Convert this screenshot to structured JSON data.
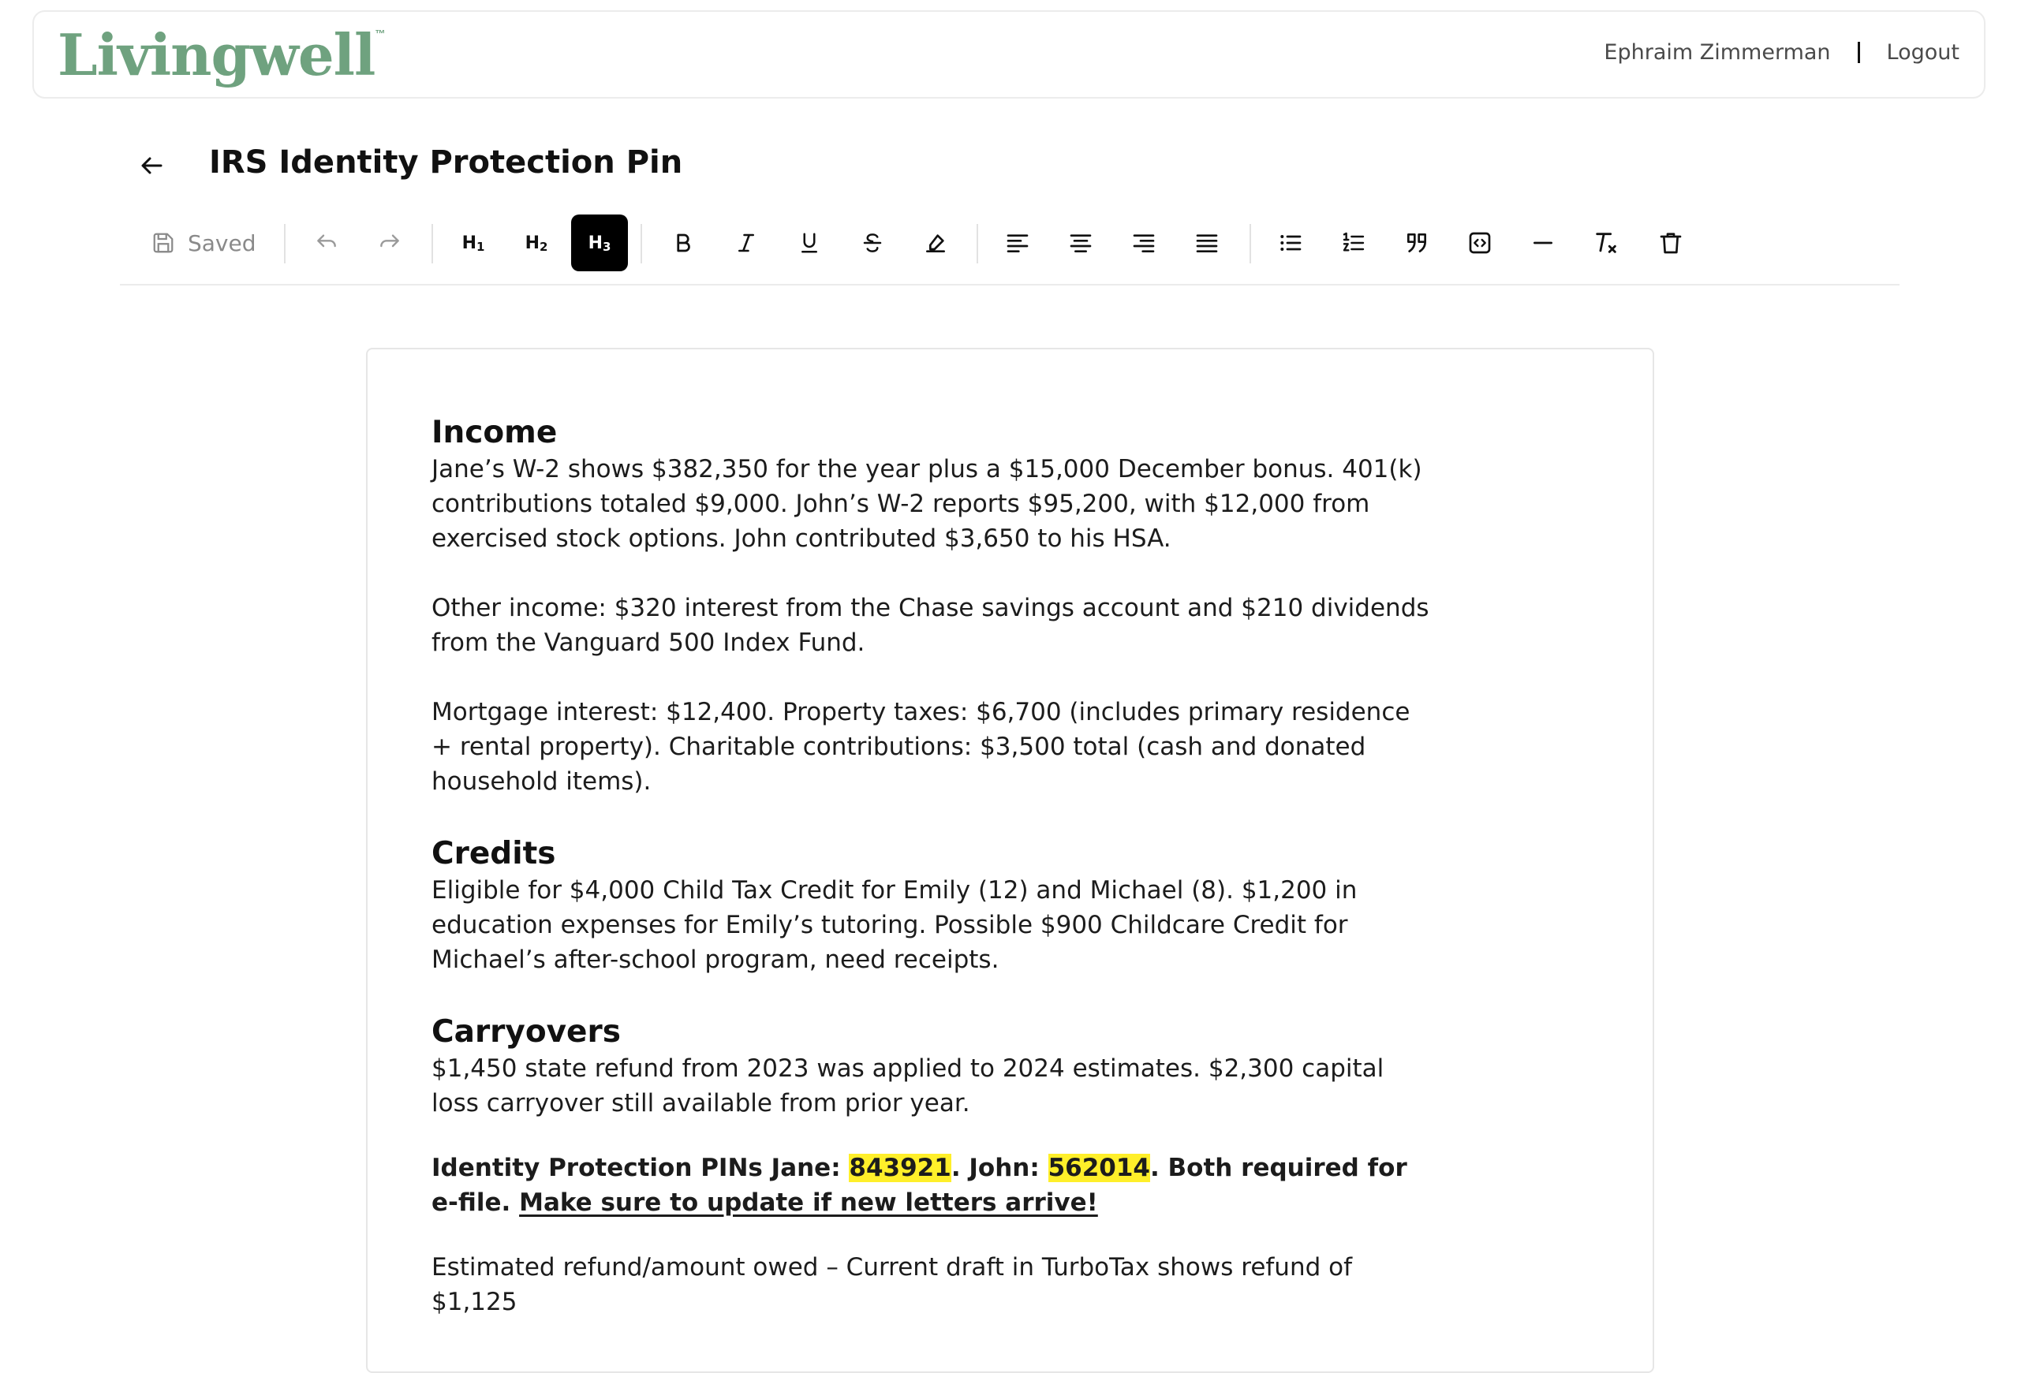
{
  "header": {
    "logo_text": "Livingwell",
    "logo_mark": "™",
    "user_name": "Ephraim Zimmerman",
    "logout_label": "Logout"
  },
  "document": {
    "title": "IRS Identity Protection Pin"
  },
  "toolbar": {
    "saved_label": "Saved",
    "h1_label": "H",
    "h1_sub": "1",
    "h2_label": "H",
    "h2_sub": "2",
    "h3_label": "H",
    "h3_sub": "3",
    "active_heading": "H3"
  },
  "content": {
    "income_heading": "Income",
    "income_p1": "Jane’s W-2 shows $382,350 for the year plus a $15,000 December bonus. 401(k) contributions totaled $9,000. John’s W-2 reports $95,200, with $12,000 from exercised stock options. John contributed $3,650 to his HSA.",
    "income_p2": "Other income: $320 interest from the Chase savings account and $210 dividends from the Vanguard 500 Index Fund.",
    "income_p3": "Mortgage interest: $12,400. Property taxes: $6,700 (includes primary residence + rental property). Charitable contributions: $3,500 total (cash and donated household items).",
    "credits_heading": "Credits",
    "credits_p1": "Eligible for $4,000 Child Tax Credit for Emily (12) and Michael (8). $1,200 in education expenses for Emily’s tutoring. Possible $900 Childcare Credit for Michael’s after-school program, need receipts.",
    "carryovers_heading": "Carryovers",
    "carryovers_p1": "$1,450 state refund from 2023 was applied to 2024 estimates. $2,300 capital loss carryover still available from prior year.",
    "pin_prefix": "Identity Protection PINs Jane: ",
    "pin_jane": "843921",
    "pin_mid": ". John: ",
    "pin_john": "562014",
    "pin_suffix": ". Both required for e-file. ",
    "pin_underlined": "Make sure to update if new letters arrive!",
    "estimate_p": "Estimated refund/amount owed – Current draft in TurboTax shows refund of $1,125"
  },
  "colors": {
    "brand_green": "#6fa27f",
    "highlight_yellow": "#ffef2a",
    "active_button_bg": "#000000"
  }
}
